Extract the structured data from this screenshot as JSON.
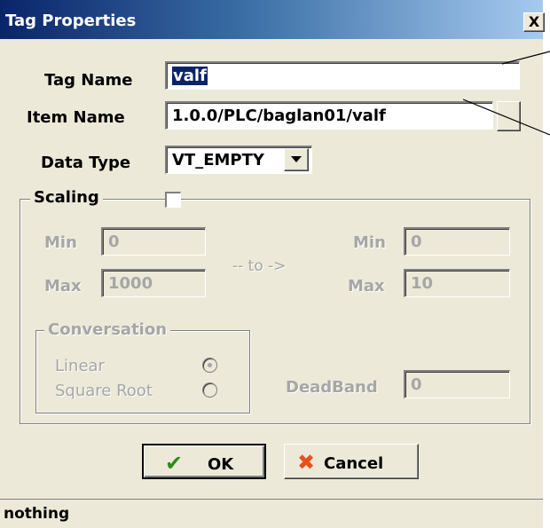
{
  "window": {
    "title": "Tag Properties",
    "close_label": "X"
  },
  "form": {
    "tag_name_label": "Tag Name",
    "tag_name_value": "valf",
    "item_name_label": "Item Name",
    "item_name_value": "1.0.0/PLC/baglan01/valf",
    "data_type_label": "Data Type",
    "data_type_value": "VT_EMPTY"
  },
  "scaling": {
    "label": "Scaling",
    "checked": false,
    "min_label_left": "Min",
    "min_value_left": "0",
    "max_label_left": "Max",
    "max_value_left": "1000",
    "to_label": "-- to ->",
    "min_label_right": "Min",
    "min_value_right": "0",
    "max_label_right": "Max",
    "max_value_right": "10",
    "conversation": {
      "label": "Conversation",
      "linear_label": "Linear",
      "linear_selected": true,
      "square_root_label": "Square Root",
      "square_root_selected": false
    },
    "deadband_label": "DeadBand",
    "deadband_value": "0"
  },
  "buttons": {
    "ok_label": "OK",
    "cancel_label": "Cancel"
  },
  "status": {
    "text": "nothing"
  },
  "colors": {
    "ok_check": "#2e8b1a",
    "cancel_x": "#e8501e"
  },
  "icons": {
    "ok": "check-icon",
    "cancel": "x-icon",
    "dropdown": "chevron-down-icon"
  }
}
